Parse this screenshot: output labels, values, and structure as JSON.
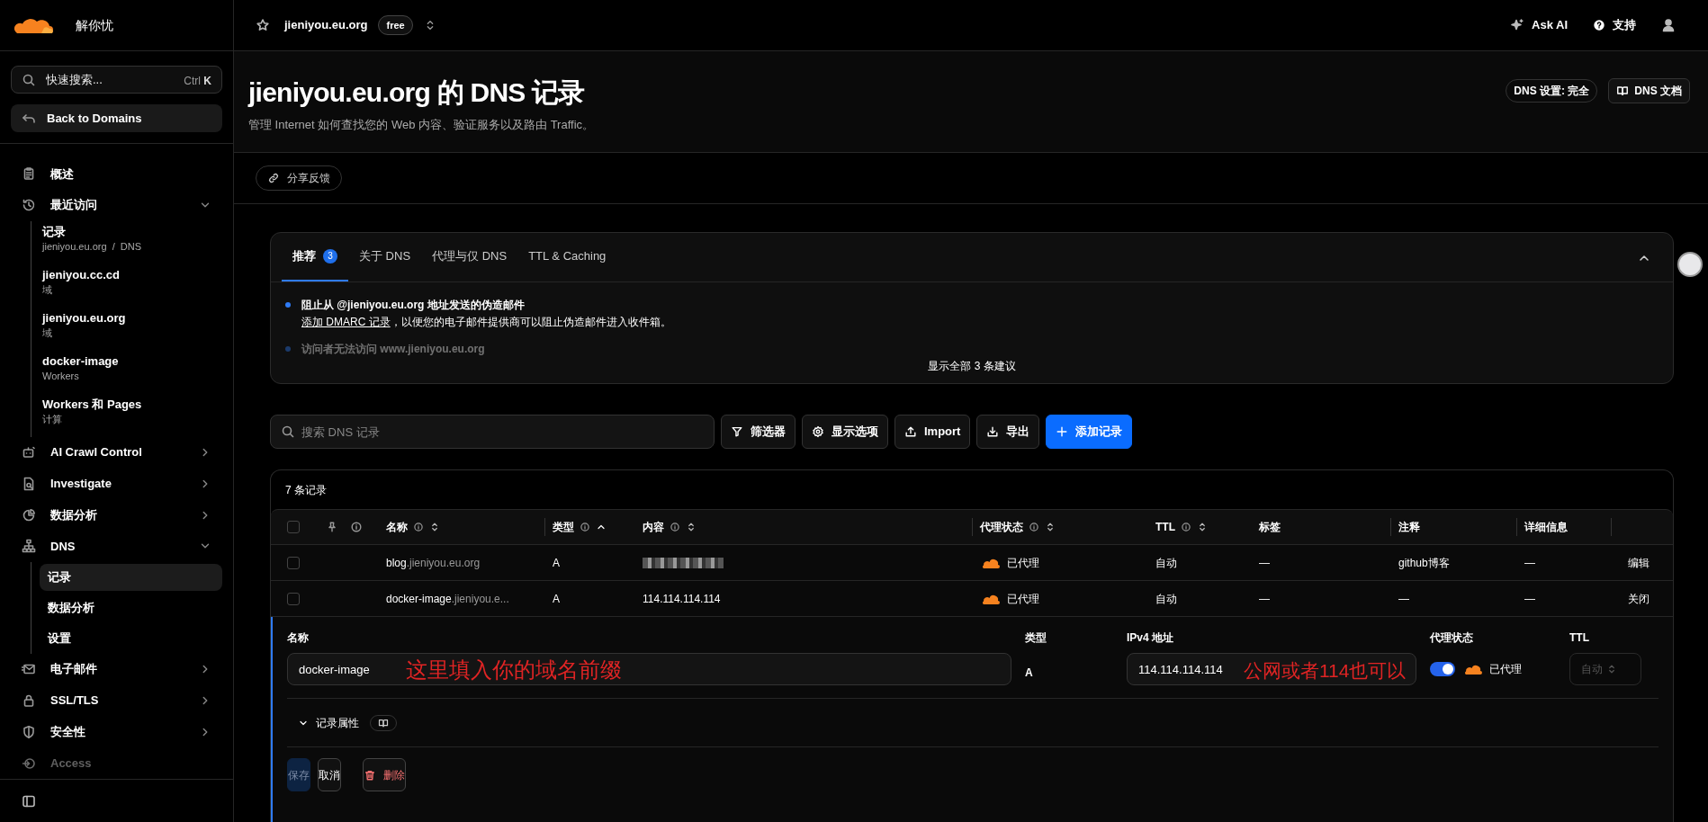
{
  "sidebar": {
    "brand": "解你忧",
    "search": {
      "placeholder": "快速搜索...",
      "shortcut_mod": "Ctrl",
      "shortcut_key": "K"
    },
    "back": "Back to Domains",
    "nav": [
      {
        "label": "概述",
        "disabled": false
      },
      {
        "label": "最近访问",
        "disabled": false,
        "expanded": true,
        "children": [
          {
            "label": "记录",
            "sub": "jieniyou.eu.org  /  DNS",
            "selected": false
          },
          {
            "label": "jieniyou.cc.cd",
            "sub": "域",
            "selected": false
          },
          {
            "label": "jieniyou.eu.org",
            "sub": "域",
            "selected": false
          },
          {
            "label": "docker-image",
            "sub": "Workers",
            "selected": false
          },
          {
            "label": "Workers 和 Pages",
            "sub": "计算",
            "selected": false
          }
        ]
      },
      {
        "label": "AI Crawl Control",
        "disabled": false,
        "expanded": false
      },
      {
        "label": "Investigate",
        "disabled": false,
        "expanded": false
      },
      {
        "label": "数据分析",
        "disabled": false,
        "expanded": false
      },
      {
        "label": "DNS",
        "disabled": false,
        "expanded": true,
        "children": [
          {
            "label": "记录",
            "selected": true
          },
          {
            "label": "数据分析",
            "selected": false
          },
          {
            "label": "设置",
            "selected": false
          }
        ]
      },
      {
        "label": "电子邮件",
        "disabled": false,
        "expanded": false
      },
      {
        "label": "SSL/TLS",
        "disabled": false,
        "expanded": false
      },
      {
        "label": "安全性",
        "disabled": false,
        "expanded": false
      },
      {
        "label": "Access",
        "disabled": true
      }
    ]
  },
  "topbar": {
    "domain": "jieniyou.eu.org",
    "plan": "free",
    "ask_ai": "Ask AI",
    "support": "支持"
  },
  "header": {
    "title": "jieniyou.eu.org 的 DNS 记录",
    "subtitle": "管理 Internet 如何查找您的 Web 内容、验证服务以及路由 Traffic。",
    "setting": "DNS 设置: 完全",
    "docs": "DNS 文档",
    "feedback": "分享反馈"
  },
  "recommendations": {
    "tabs": [
      {
        "label": "推荐",
        "count": "3",
        "selected": true
      },
      {
        "label": "关于 DNS",
        "selected": false
      },
      {
        "label": "代理与仅 DNS",
        "selected": false
      },
      {
        "label": "TTL & Caching",
        "selected": false
      }
    ],
    "items": [
      {
        "title": "阻止从 @jieniyou.eu.org 地址发送的伪造邮件",
        "link": "添加 DMARC 记录",
        "body": "，以便您的电子邮件提供商可以阻止伪造邮件进入收件箱。",
        "faded": false
      },
      {
        "title": "访问者无法访问 www.jieniyou.eu.org",
        "faded": true
      }
    ],
    "show_all": "显示全部 3 条建议"
  },
  "toolbar": {
    "search_placeholder": "搜索 DNS 记录",
    "buttons": [
      {
        "label": "筛选器",
        "kind": "default"
      },
      {
        "label": "显示选项",
        "kind": "default"
      },
      {
        "label": "Import",
        "kind": "default"
      },
      {
        "label": "导出",
        "kind": "default"
      },
      {
        "label": "添加记录",
        "kind": "primary"
      }
    ]
  },
  "table": {
    "count": "7 条记录",
    "columns": [
      {
        "label": "名称",
        "info": true,
        "sortable": true,
        "sorted_ascending": false
      },
      {
        "label": "类型",
        "info": true,
        "sortable": true,
        "sorted_ascending": true
      },
      {
        "label": "内容",
        "info": true,
        "sortable": true,
        "sorted_ascending": false
      },
      {
        "label": "代理状态",
        "info": true,
        "sortable": true,
        "sorted_ascending": false
      },
      {
        "label": "TTL",
        "info": true,
        "sortable": true,
        "sorted_ascending": false
      },
      {
        "label": "标签",
        "info": false,
        "sortable": false
      },
      {
        "label": "注释",
        "info": false,
        "sortable": false
      },
      {
        "label": "详细信息",
        "info": false,
        "sortable": false
      }
    ],
    "all_checked": false,
    "rows": [
      {
        "checked": false,
        "name": "blog",
        "domain": ".jieniyou.eu.org",
        "type": "A",
        "content_redacted": true,
        "proxy": "已代理",
        "ttl": "自动",
        "tags": "—",
        "comment": "github博客",
        "details": "—",
        "action": "编辑"
      },
      {
        "checked": false,
        "name": "docker-image",
        "domain": ".jieniyou.e...",
        "type": "A",
        "content_redacted": false,
        "content": "114.114.114.114",
        "proxy": "已代理",
        "ttl": "自动",
        "tags": "—",
        "comment": "—",
        "details": "—",
        "action": "关闭"
      }
    ]
  },
  "edit_form": {
    "name_label": "名称",
    "name_value": "docker-image",
    "type_label": "类型",
    "type_value": "A",
    "ip_label": "IPv4 地址",
    "ip_value": "114.114.114.114",
    "proxy_label": "代理状态",
    "proxy_on": true,
    "proxy_text": "已代理",
    "ttl_label": "TTL",
    "ttl_value": "自动",
    "ttl_disabled": true,
    "attributes": "记录属性",
    "attributes_expanded": false,
    "buttons": [
      {
        "label": "保存",
        "kind": "primary",
        "disabled": true
      },
      {
        "label": "取消",
        "kind": "default",
        "disabled": false
      },
      {
        "label": "删除",
        "kind": "danger",
        "disabled": false
      }
    ],
    "annotations": [
      {
        "text": "这里填入你的域名前缀",
        "color": "#e02424"
      },
      {
        "text": "公网或者114也可以",
        "color": "#e02424"
      }
    ]
  }
}
